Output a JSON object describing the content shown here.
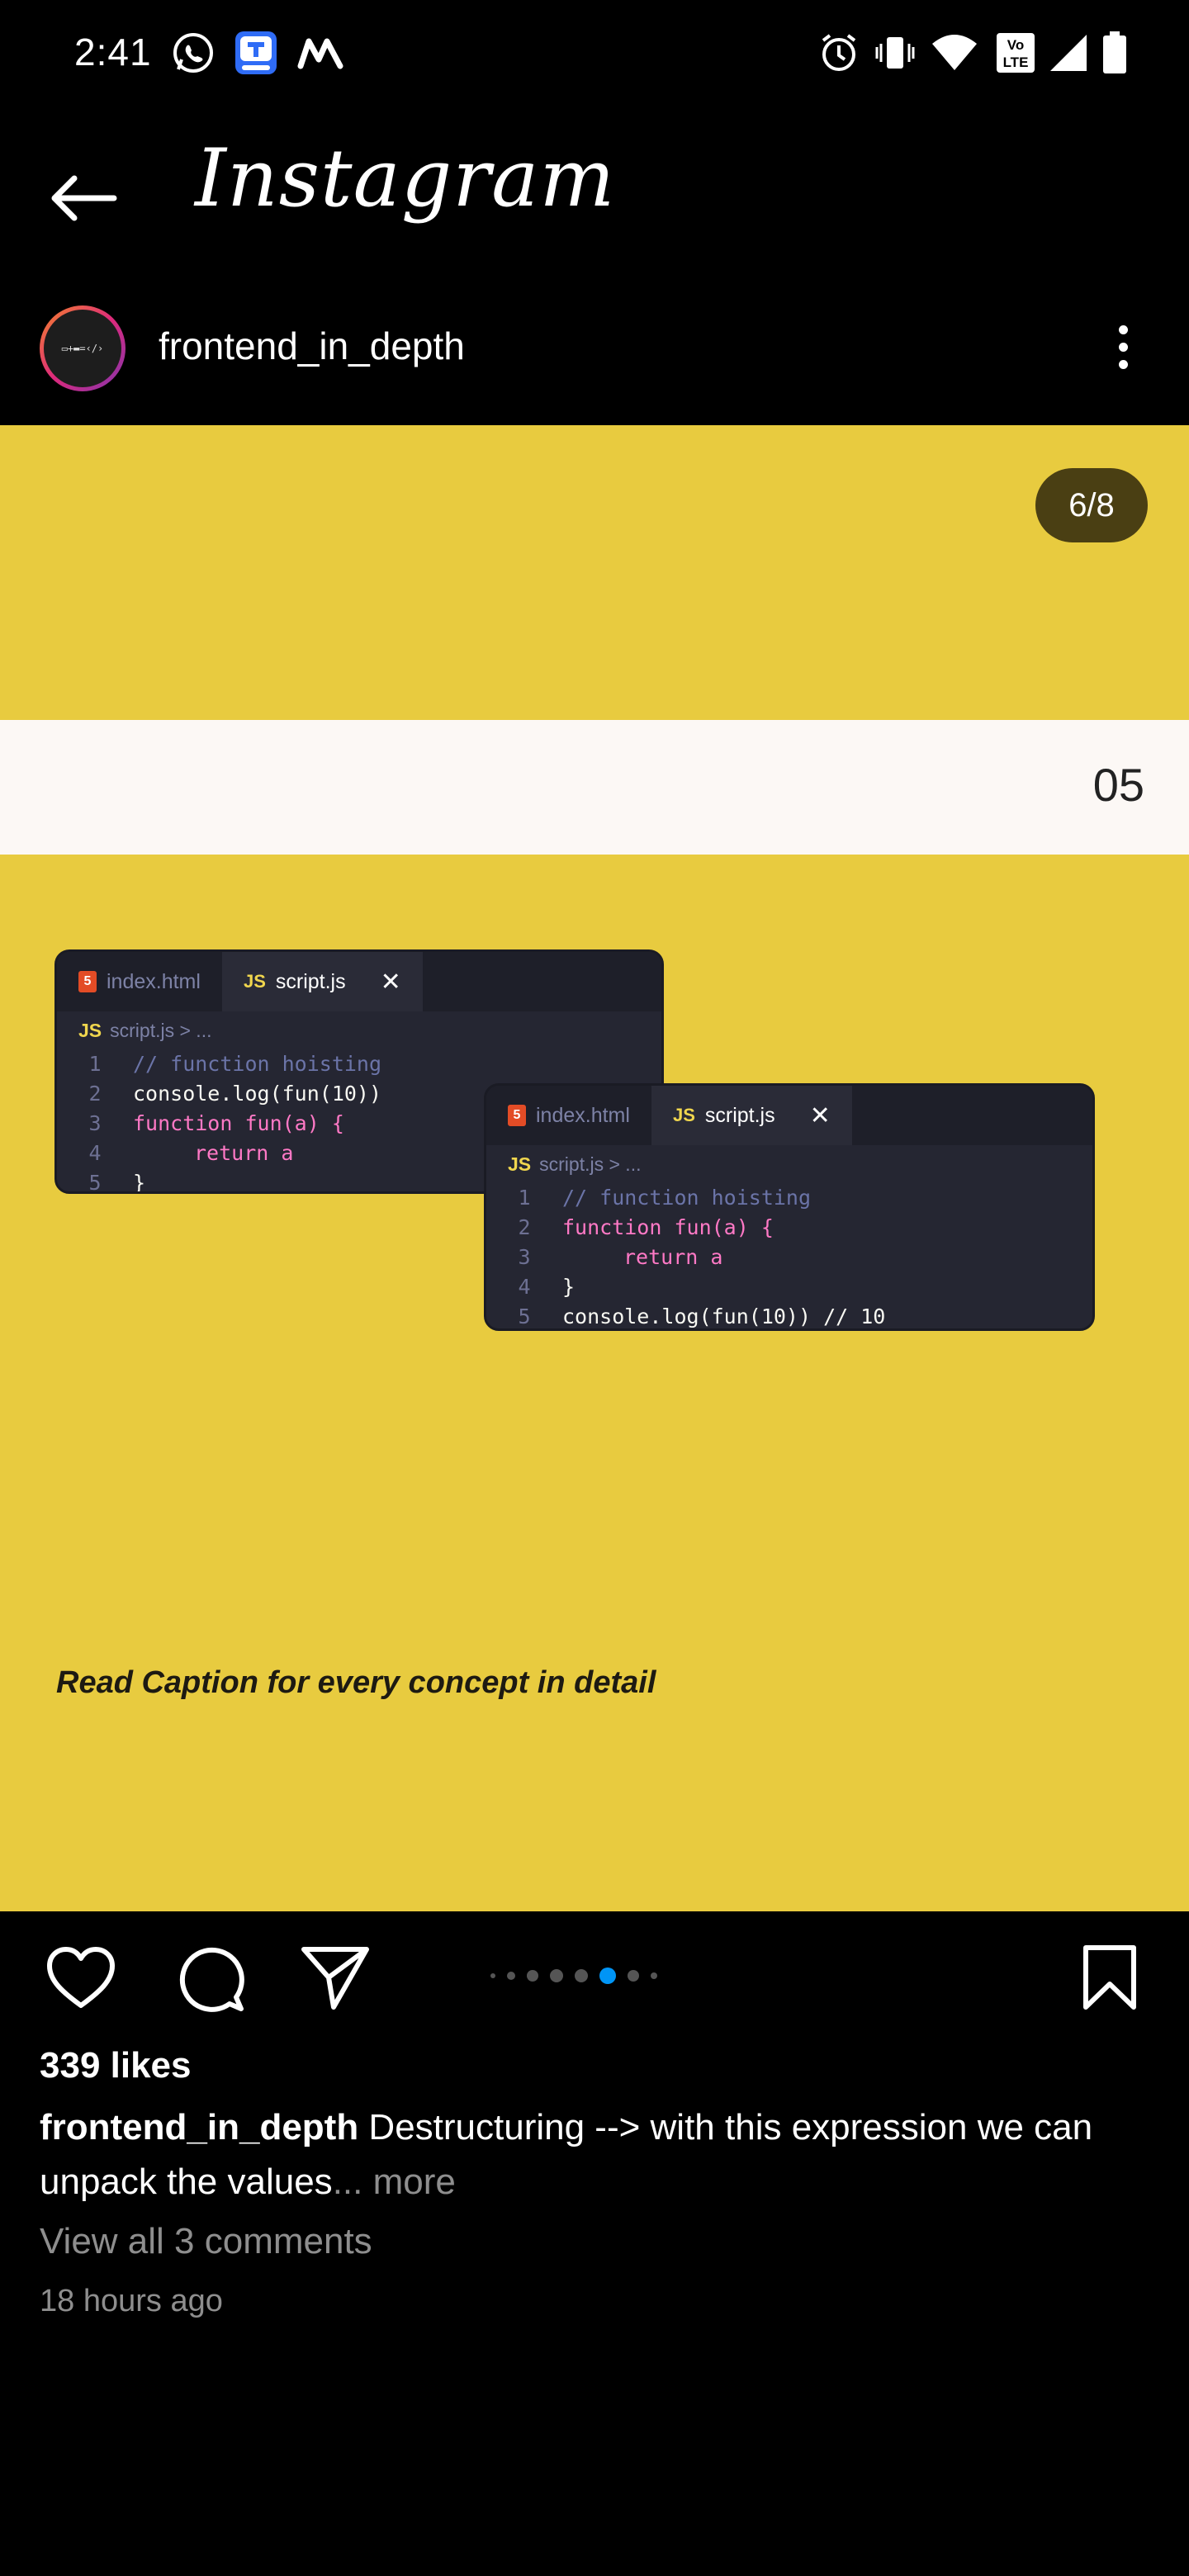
{
  "status_bar": {
    "time": "2:41"
  },
  "header": {
    "brand": "Instagram"
  },
  "post": {
    "username": "frontend_in_depth",
    "slide_counter": "6/8",
    "slide_number": "05",
    "footer_text": "Read Caption for every concept in detail",
    "editor_a": {
      "tab1": "index.html",
      "tab2": "script.js",
      "crumb": "script.js > ...",
      "lines": [
        {
          "n": "1",
          "t": "// function hoisting"
        },
        {
          "n": "2",
          "t": "console.log(fun(10))"
        },
        {
          "n": "3",
          "t": "function fun(a) {"
        },
        {
          "n": "4",
          "t": "return a"
        },
        {
          "n": "5",
          "t": "}"
        }
      ]
    },
    "editor_b": {
      "tab1": "index.html",
      "tab2": "script.js",
      "crumb": "script.js > ...",
      "lines": [
        {
          "n": "1",
          "t": "// function hoisting"
        },
        {
          "n": "2",
          "t": "function fun(a) {"
        },
        {
          "n": "3",
          "t": "return a"
        },
        {
          "n": "4",
          "t": "}"
        },
        {
          "n": "5",
          "t": "console.log(fun(10)) // 10"
        }
      ]
    },
    "carousel": {
      "total": 8,
      "current": 6
    },
    "likes": "339 likes",
    "caption_user": "frontend_in_depth",
    "caption_text": " Destructuring --> with this expression we can unpack the values",
    "caption_more": "... more",
    "comments_link": "View all 3 comments",
    "time_ago": "18 hours ago"
  },
  "colors": {
    "media_bg": "#e8cb3f",
    "active_dot": "#0095f6",
    "inactive_dot": "#555555"
  },
  "icons": [
    "whatsapp-icon",
    "app-icon",
    "mail-icon",
    "alarm-icon",
    "vibrate-icon",
    "wifi-icon",
    "volte-icon",
    "signal-icon",
    "battery-icon",
    "back-arrow-icon",
    "more-options-icon",
    "heart-icon",
    "comment-icon",
    "share-icon",
    "bookmark-icon"
  ]
}
